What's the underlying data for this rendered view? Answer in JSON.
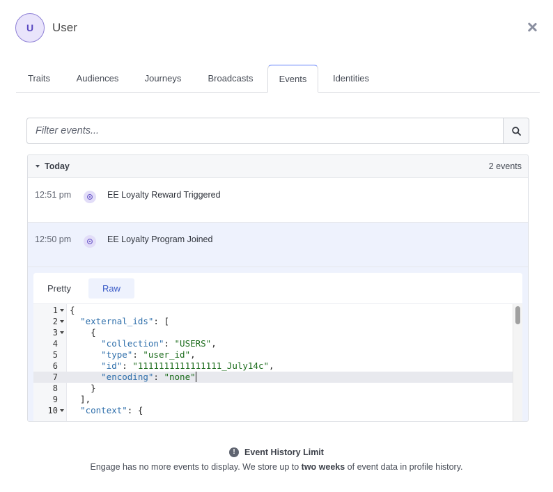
{
  "user": {
    "avatar_initial": "U",
    "name": "User"
  },
  "tabs": [
    {
      "label": "Traits"
    },
    {
      "label": "Audiences"
    },
    {
      "label": "Journeys"
    },
    {
      "label": "Broadcasts"
    },
    {
      "label": "Events",
      "active": true
    },
    {
      "label": "Identities"
    }
  ],
  "filter": {
    "placeholder": "Filter events..."
  },
  "events": {
    "group_title": "Today",
    "group_count": "2 events",
    "items": [
      {
        "time": "12:51 pm",
        "name": "EE Loyalty Reward Triggered"
      },
      {
        "time": "12:50 pm",
        "name": "EE Loyalty Program Joined",
        "selected": true
      }
    ]
  },
  "detail": {
    "view_tabs": [
      {
        "label": "Pretty"
      },
      {
        "label": "Raw",
        "active": true
      }
    ],
    "code_lines": [
      {
        "n": "1",
        "fold": true,
        "html": "{"
      },
      {
        "n": "2",
        "fold": true,
        "html": "  <span class=\"k\">\"external_ids\"</span>: ["
      },
      {
        "n": "3",
        "fold": true,
        "html": "    {"
      },
      {
        "n": "4",
        "fold": false,
        "html": "      <span class=\"k\">\"collection\"</span>: <span class=\"s\">\"USERS\"</span>,"
      },
      {
        "n": "5",
        "fold": false,
        "html": "      <span class=\"k\">\"type\"</span>: <span class=\"s\">\"user_id\"</span>,"
      },
      {
        "n": "6",
        "fold": false,
        "html": "      <span class=\"k\">\"id\"</span>: <span class=\"s\">\"1111111111111111_July14c\"</span>,"
      },
      {
        "n": "7",
        "fold": false,
        "active": true,
        "html": "      <span class=\"k\">\"encoding\"</span>: <span class=\"s\">\"none\"</span><span class=\"cursor\"></span>"
      },
      {
        "n": "8",
        "fold": false,
        "html": "    }"
      },
      {
        "n": "9",
        "fold": false,
        "html": "  ],"
      },
      {
        "n": "10",
        "fold": true,
        "html": "  <span class=\"k\">\"context\"</span>: {"
      }
    ]
  },
  "notice": {
    "title": "Event History Limit",
    "text_before": "Engage has no more events to display. We store up to ",
    "text_bold": "two weeks",
    "text_after": " of event data in profile history."
  }
}
